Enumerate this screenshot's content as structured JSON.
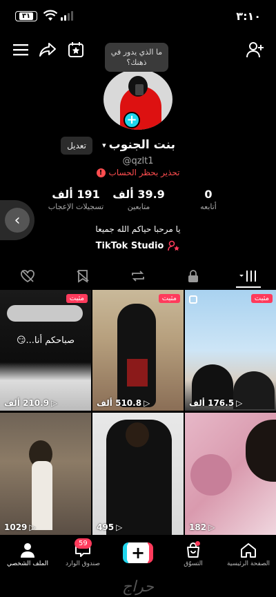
{
  "status": {
    "time": "٣:١٠",
    "battery": "٣١"
  },
  "profile": {
    "bubble": "ما الذي يدور في ذهنك؟",
    "name": "بنت الجنوب",
    "edit_label": "تعديل",
    "username": "@qzlt1",
    "warning": "تحذير بحظر الحساب",
    "bio": "يا مرحبا حياكم الله جميعا",
    "studio": "TikTok Studio"
  },
  "stats": [
    {
      "num": "0",
      "label": "أتابعه"
    },
    {
      "num": "39.9 ألف",
      "label": "متابعين"
    },
    {
      "num": "191 ألف",
      "label": "تسجيلات الإعجاب"
    }
  ],
  "videos": [
    {
      "pinned": "مثبت",
      "views": "210.9 ألف",
      "caption": "صباحكم أنا...😏"
    },
    {
      "pinned": "مثبت",
      "views": "510.8 ألف",
      "caption": ""
    },
    {
      "pinned": "مثبت",
      "views": "176.5 ألف",
      "caption": ""
    },
    {
      "pinned": "",
      "views": "1029",
      "caption": ""
    },
    {
      "pinned": "",
      "views": "495",
      "caption": ""
    },
    {
      "pinned": "",
      "views": "182",
      "caption": ""
    }
  ],
  "nav": {
    "profile": "الملف الشخصي",
    "inbox": "صندوق الوارد",
    "inbox_badge": "59",
    "shop": "التسوّق",
    "home": "الصفحة الرئيسية"
  },
  "watermark": "حراج",
  "colors": {
    "accent": "#ff3b5c",
    "cyan": "#20d5ec",
    "warning": "#ff4d4f"
  }
}
